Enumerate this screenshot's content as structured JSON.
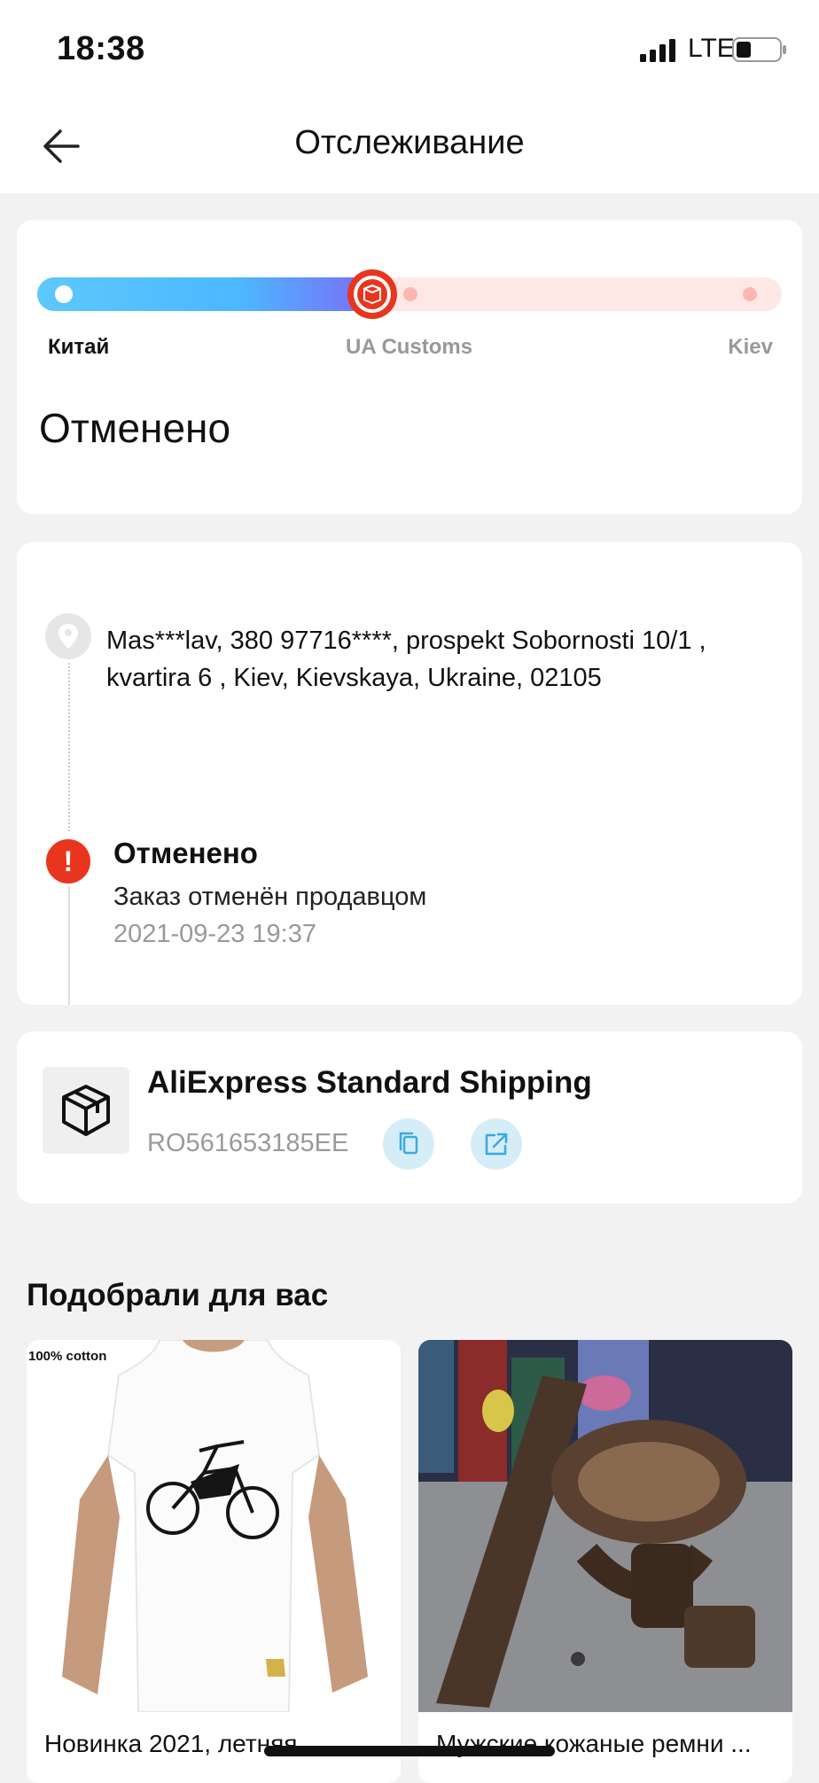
{
  "status_bar": {
    "time": "18:38",
    "network": "LTE"
  },
  "header": {
    "title": "Отслеживание"
  },
  "progress": {
    "stages": [
      "Китай",
      "UA Customs",
      "Kiev"
    ],
    "current_stage_index": 1,
    "status": "Отменено",
    "colors": {
      "done": "#4cb8ff",
      "pending": "#fde8e6",
      "current": "#e8361e"
    }
  },
  "timeline": {
    "address": "Mas***lav,  380 97716****,  prospekt Sobornosti 10/1 , kvartira 6 ,  Kiev,  Kievskaya,  Ukraine,  02105",
    "event": {
      "title": "Отменено",
      "description": "Заказ отменён продавцом",
      "time": "2021-09-23 19:37"
    }
  },
  "shipping": {
    "carrier": "AliExpress Standard Shipping",
    "tracking_number": "RO561653185EE"
  },
  "recommendations": {
    "title": "Подобрали для вас",
    "items": [
      {
        "title": "Новинка 2021, летняя",
        "badge": "100% cotton"
      },
      {
        "title": "Мужские кожаные ремни ..."
      }
    ]
  }
}
